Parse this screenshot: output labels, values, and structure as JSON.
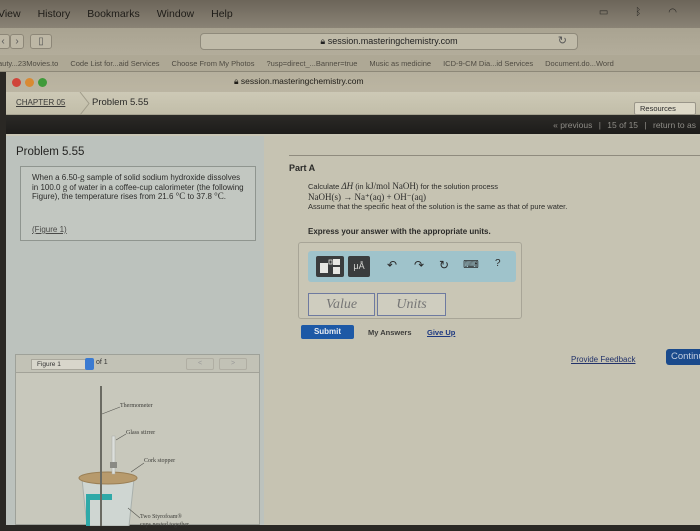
{
  "menubar": {
    "items": [
      "View",
      "History",
      "Bookmarks",
      "Window",
      "Help"
    ],
    "tray_icons": [
      "airplay-icon",
      "bluetooth-icon",
      "wifi-icon"
    ]
  },
  "browser": {
    "url": "session.masteringchemistry.com",
    "window_title": "session.masteringchemistry.com",
    "bookmarks": [
      "auty...23Movies.to",
      "Code List for...aid Services",
      "Choose From My Photos",
      "?usp=direct_...Banner=true",
      "Music as medicine",
      "ICD-9-CM Dia...id Services",
      "Document.do...Word"
    ]
  },
  "breadcrumb": {
    "chapter": "CHAPTER 05",
    "problem": "Problem 5.55"
  },
  "resources_label": "Resources",
  "pager": {
    "previous": "« previous",
    "position": "15 of 15",
    "return": "return to as"
  },
  "problem": {
    "title": "Problem 5.55",
    "text_1": "When a 6.50-",
    "unit_g": "g",
    "text_2": " sample of solid sodium hydroxide dissolves in 100.0 ",
    "text_3": " of water in a coffee-cup calorimeter (the following Figure), the temperature rises from 21.6 ",
    "deg_c_1": "°C",
    "text_4": " to 37.8 ",
    "deg_c_2": "°C",
    "text_5": ".",
    "figure_link": "(Figure 1)"
  },
  "figure": {
    "selected": "Figure 1",
    "of": "of 1",
    "prev": "<",
    "next": ">",
    "labels": {
      "thermometer": "Thermometer",
      "stirrer": "Glass stirrer",
      "stopper": "Cork stopper",
      "cups": "Two Styrofoam®",
      "cups_2": "cups nested together"
    }
  },
  "part_a": {
    "label": "Part A",
    "line1_a": "Calculate ",
    "line1_math": "ΔH",
    "line1_b": " (in ",
    "line1_units": "kJ/mol NaOH",
    "line1_c": ") for the solution process",
    "equation": "NaOH(s) → Na⁺(aq) + OH⁻(aq)",
    "line3": "Assume that the specific heat of the solution is the same as that of pure water.",
    "instruction": "Express your answer with the appropriate units."
  },
  "answer": {
    "toolbar": {
      "template_icon": "fraction-template-icon",
      "units_label": "μÅ",
      "undo": "↶",
      "redo": "↷",
      "reset": "↻",
      "keyboard": "⌨",
      "help": "?"
    },
    "value_placeholder": "Value",
    "units_placeholder": "Units",
    "submit": "Submit",
    "my_answers": "My Answers",
    "give_up": "Give Up"
  },
  "footer": {
    "feedback": "Provide Feedback",
    "continue": "Continue"
  },
  "colors": {
    "submit_blue": "#1d59a6",
    "link_blue": "#1d3880",
    "toolbar_teal": "#9fc3cb"
  }
}
